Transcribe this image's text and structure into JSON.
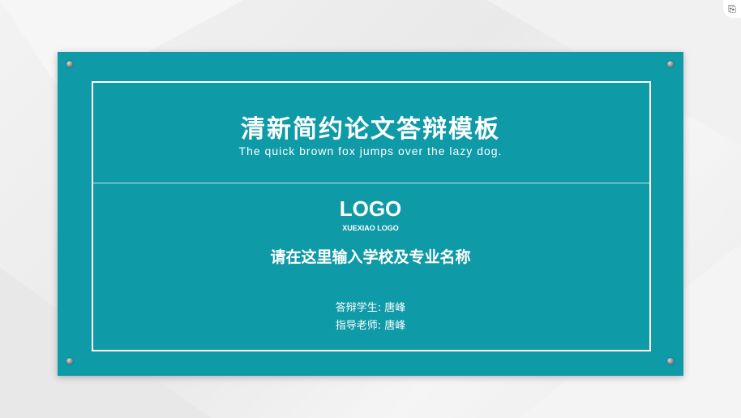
{
  "slide": {
    "title": "清新简约论文答辩模板",
    "subtitle": "The quick brown fox jumps over the lazy dog.",
    "logo": "LOGO",
    "logo_sub": "XUEXIAO LOGO",
    "school": "请在这里输入学校及专业名称",
    "student_label": "答辩学生:",
    "student_name": "唐峰",
    "advisor_label": "指导老师:",
    "advisor_name": "唐峰"
  },
  "colors": {
    "slide_bg": "#0e9aa7",
    "text": "#ffffff",
    "canvas_bg": "#ededed"
  },
  "icons": {
    "corner": "paste-icon",
    "bolts": "screw-bolt-icon"
  }
}
